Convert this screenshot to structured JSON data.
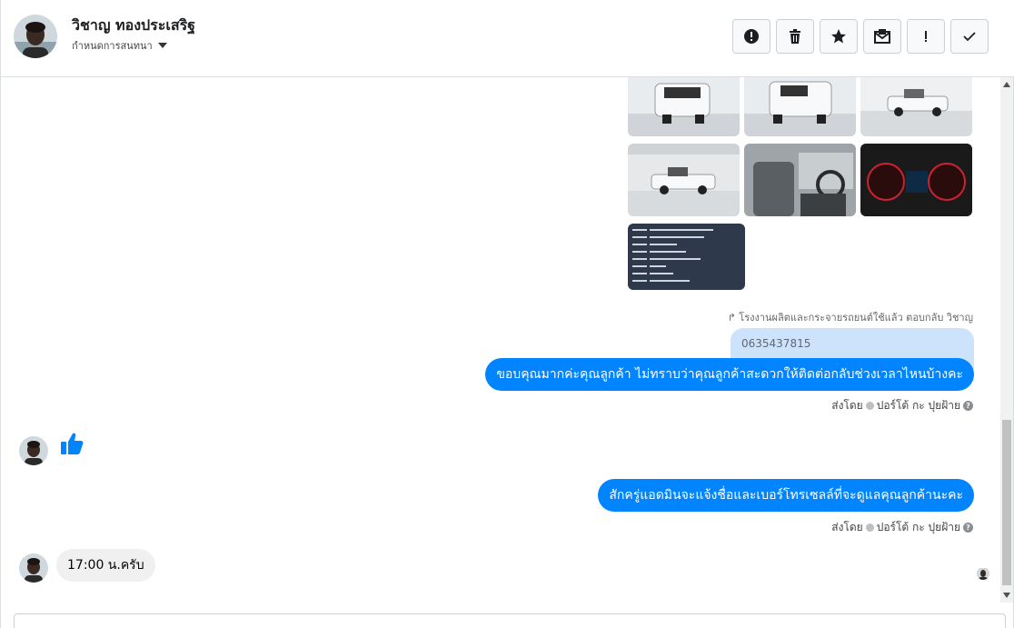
{
  "header": {
    "contact_name": "วิชาญ ทองประเสริฐ",
    "subtitle": "กำหนดการสนทนา",
    "actions": [
      {
        "name": "spam-icon"
      },
      {
        "name": "trash-icon"
      },
      {
        "name": "star-icon"
      },
      {
        "name": "mark-unread-icon"
      },
      {
        "name": "exclamation-icon"
      },
      {
        "name": "checkmark-icon"
      }
    ]
  },
  "thread": {
    "reply_meta": "โรงงานผลิตและกระจายรถยนต์ใช้แล้ว ตอบกลับ วิชาญ",
    "quoted_text": "0635437815",
    "outgoing_1": "ขอบคุณมากค่ะคุณลูกค้า ไม่ทราบว่าคุณลูกค้าสะดวกให้ติดต่อกลับช่วงเวลาไหนบ้างคะ",
    "sender_1": "ส่งโดย",
    "sender_1_name": "ปอร์โต้ กะ ปุยฝ้าย",
    "outgoing_2": "สักครู่แอดมินจะแจ้งชื่อและเบอร์โทรเซลล์ที่จะดูแลคุณลูกค้านะคะ",
    "sender_2": "ส่งโดย",
    "sender_2_name": "ปอร์โต้ กะ ปุยฝ้าย",
    "incoming_last": "17:00 น.ครับ"
  },
  "colors": {
    "accent": "#0084ff",
    "incoming_bg": "#f0f0f0",
    "quoted_bg": "#cde3fb"
  }
}
